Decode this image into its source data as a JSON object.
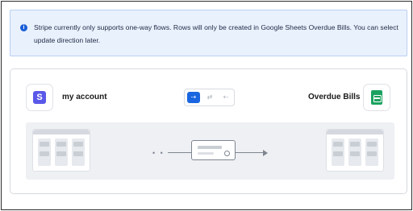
{
  "alert": {
    "icon": "info-icon",
    "message": "Stripe currently only supports one-way flows. Rows will only be created in Google Sheets Overdue Bills. You can select update direction later."
  },
  "source": {
    "icon": "stripe-logo-icon",
    "name": "my account",
    "brand_color": "#5a58e8"
  },
  "destination": {
    "icon": "google-sheets-icon",
    "name": "Overdue Bills",
    "brand_color": "#1aa260"
  },
  "direction_toggle": {
    "options": [
      {
        "icon": "arrow-right-icon",
        "glyph": "⇢",
        "active": true
      },
      {
        "icon": "arrows-bidirectional-icon",
        "glyph": "⇄",
        "active": false
      },
      {
        "icon": "arrow-left-icon",
        "glyph": "⇠",
        "active": false
      }
    ],
    "accent_color": "#1a66e0"
  }
}
